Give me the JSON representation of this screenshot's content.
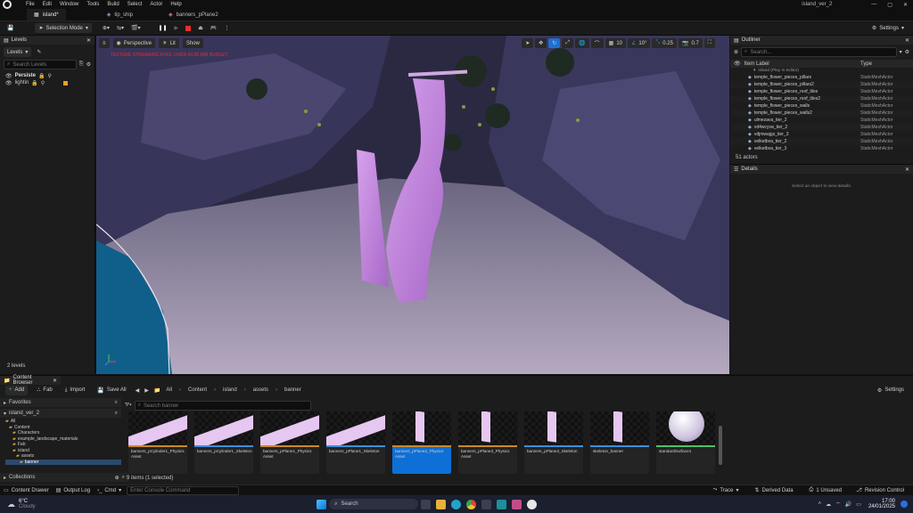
{
  "menubar": {
    "items": [
      "File",
      "Edit",
      "Window",
      "Tools",
      "Build",
      "Select",
      "Actor",
      "Help"
    ],
    "project_name": "island_ver_2"
  },
  "tabs": {
    "level_tab": "island*",
    "tab2": "tip_ship",
    "tab3": "banners_pPlane2"
  },
  "toolbar": {
    "selection_mode": "Selection Mode",
    "settings": "Settings"
  },
  "levels_panel": {
    "tab_title": "Levels",
    "levels_dropdown": "Levels",
    "search_placeholder": "Search Levels",
    "rows": [
      "Persiste",
      "lightin"
    ],
    "footer": "2 levels"
  },
  "viewport": {
    "perspective": "Perspective",
    "lit": "Lit",
    "show": "Show",
    "warning": "TEXTURE STREAMING POOL OVER 94.00 MIB BUDGET",
    "grid_value": "10",
    "rotation_value": "10°",
    "scale_value": "0.25",
    "camera_speed": "0.7"
  },
  "outliner": {
    "tab_title": "Outliner",
    "search_placeholder": "Search...",
    "col_label": "Item Label",
    "col_type": "Type",
    "root": "island (Play In Editor)",
    "items": [
      {
        "label": "temple_flower_pieces_pillars",
        "type": "StaticMeshActor"
      },
      {
        "label": "temple_flower_pieces_pillars2",
        "type": "StaticMeshActor"
      },
      {
        "label": "temple_flower_pieces_roof_tiles",
        "type": "StaticMeshActor"
      },
      {
        "label": "temple_flower_pieces_roof_tiles2",
        "type": "StaticMeshActor"
      },
      {
        "label": "temple_flower_pieces_walls",
        "type": "StaticMeshActor"
      },
      {
        "label": "temple_flower_pieces_walls2",
        "type": "StaticMeshActor"
      },
      {
        "label": "ulmezava_tier_2",
        "type": "StaticMeshActor"
      },
      {
        "label": "vd4wcyva_tier_2",
        "type": "StaticMeshActor"
      },
      {
        "label": "vdjmwajgs_tier_3",
        "type": "StaticMeshActor"
      },
      {
        "label": "velketbva_tier_2",
        "type": "StaticMeshActor"
      },
      {
        "label": "velketbva_tier_3",
        "type": "StaticMeshActor"
      }
    ],
    "footer": "51 actors"
  },
  "details": {
    "tab_title": "Details",
    "empty_msg": "Select an object to view details."
  },
  "content_browser": {
    "tab_title": "Content Browser",
    "add": "Add",
    "fab": "Fab",
    "import": "Import",
    "save_all": "Save All",
    "breadcrumb": [
      "All",
      "Content",
      "island",
      "assets",
      "banner"
    ],
    "settings": "Settings",
    "favorites": "Favorites",
    "tree_root": "island_ver_2",
    "search_placeholder": "Search banner",
    "tree": [
      "All",
      "Content",
      "Characters",
      "example_landscape_materials",
      "Fab",
      "island",
      "assets",
      "banner"
    ],
    "collections": "Collections",
    "items_count": "9 items (1 selected)",
    "assets": [
      {
        "name": "banners_pCylinder1_Physics Asset",
        "bar": "#c8892a"
      },
      {
        "name": "banners_pCylinder1_Skeleton",
        "bar": "#3b8fd9"
      },
      {
        "name": "banners_pPlane1_Physics Asset",
        "bar": "#c8892a"
      },
      {
        "name": "banners_pPlane1_Skeleton",
        "bar": "#3b8fd9"
      },
      {
        "name": "banners_pPlane2_Physics Asset",
        "bar": "#c8892a"
      },
      {
        "name": "banners_pPlane3_Physics Asset",
        "bar": "#c8892a"
      },
      {
        "name": "banners_pPlane3_Skeleton",
        "bar": "#3b8fd9"
      },
      {
        "name": "skeleton_banner",
        "bar": "#3b8fd9"
      },
      {
        "name": "standardSurface1",
        "bar": "#4fbf6a"
      }
    ]
  },
  "statusbar": {
    "content_drawer": "Content Drawer",
    "output_log": "Output Log",
    "cmd": "Cmd",
    "console_placeholder": "Enter Console Command",
    "trace": "Trace",
    "derived_data": "Derived Data",
    "unsaved": "1 Unsaved",
    "revision_control": "Revision Control"
  },
  "taskbar": {
    "weather_temp": "6°C",
    "weather_desc": "Cloudy",
    "search": "Search",
    "time": "17:00",
    "date": "24/01/2025"
  }
}
